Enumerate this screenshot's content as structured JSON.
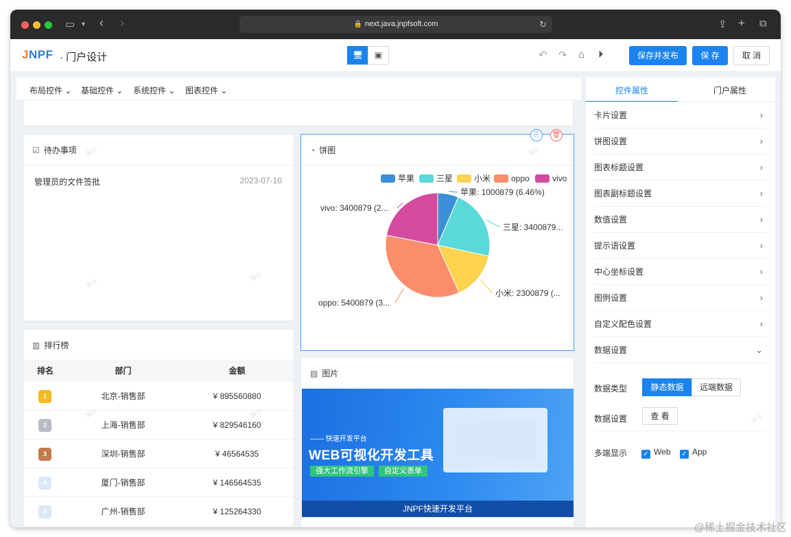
{
  "browser": {
    "url": "next.java.jnpfsoft.com"
  },
  "app": {
    "logo": "JNPF",
    "logo_j": "J",
    "logo_rest": "NPF",
    "title": "· 门户设计",
    "publish_label": "保存并发布",
    "save_label": "保 存",
    "cancel_label": "取 消"
  },
  "toolbar_tabs": [
    "布局控件",
    "基础控件",
    "系统控件",
    "图表控件"
  ],
  "todo": {
    "title": "待办事项",
    "items": [
      {
        "text": "管理员的文件签批",
        "date": "2023-07-10"
      }
    ]
  },
  "ranking": {
    "title": "排行榜",
    "columns": [
      "排名",
      "部门",
      "金额"
    ],
    "rows": [
      {
        "rank": "1",
        "dept": "北京-销售部",
        "amount": "¥ 895560880"
      },
      {
        "rank": "2",
        "dept": "上海-销售部",
        "amount": "¥ 829546160"
      },
      {
        "rank": "3",
        "dept": "深圳-销售部",
        "amount": "¥ 46564535"
      },
      {
        "rank": "4",
        "dept": "厦门-销售部",
        "amount": "¥ 146564535"
      },
      {
        "rank": "5",
        "dept": "广州-销售部",
        "amount": "¥ 125264330"
      }
    ]
  },
  "pie": {
    "title": "饼图"
  },
  "chart_data": {
    "type": "pie",
    "title": "饼图",
    "categories": [
      "苹果",
      "三星",
      "小米",
      "oppo",
      "vivo"
    ],
    "values": [
      1000879,
      3400879,
      2300879,
      5400879,
      3400879
    ],
    "colors": [
      "#3a8fd6",
      "#5bd8d9",
      "#fdd34f",
      "#fb8d6a",
      "#d44a9e"
    ],
    "labels": [
      "苹果: 1000879 (6.46%)",
      "三星: 3400879...",
      "小米: 2300879 (...",
      "oppo: 5400879 (3...",
      "vivo: 3400879 (2..."
    ],
    "legend_position": "top-right"
  },
  "image_card": {
    "title": "图片",
    "banner_sub": "—— 快速开发平台",
    "banner_title": "WEB可视化开发工具",
    "tag1": "强大工作流引擎",
    "tag2": "自定义表单",
    "footer": "JNPF快速开发平台"
  },
  "right": {
    "tab_active": "控件属性",
    "tab_other": "门户属性",
    "settings": [
      "卡片设置",
      "饼图设置",
      "图表标题设置",
      "图表副标题设置",
      "数值设置",
      "提示语设置",
      "中心坐标设置",
      "图例设置",
      "自定义配色设置",
      "数据设置"
    ],
    "data_type_label": "数据类型",
    "static_label": "静态数据",
    "remote_label": "远端数据",
    "data_set_label": "数据设置",
    "view_label": "查 看",
    "multi_label": "多端显示",
    "web_label": "Web",
    "app_label": "App"
  },
  "watermark": "@稀土掘金技术社区",
  "bg_watermark": "演示",
  "icons": {
    "chevron": "›",
    "chevron_down": "⌄",
    "check": "✓"
  }
}
